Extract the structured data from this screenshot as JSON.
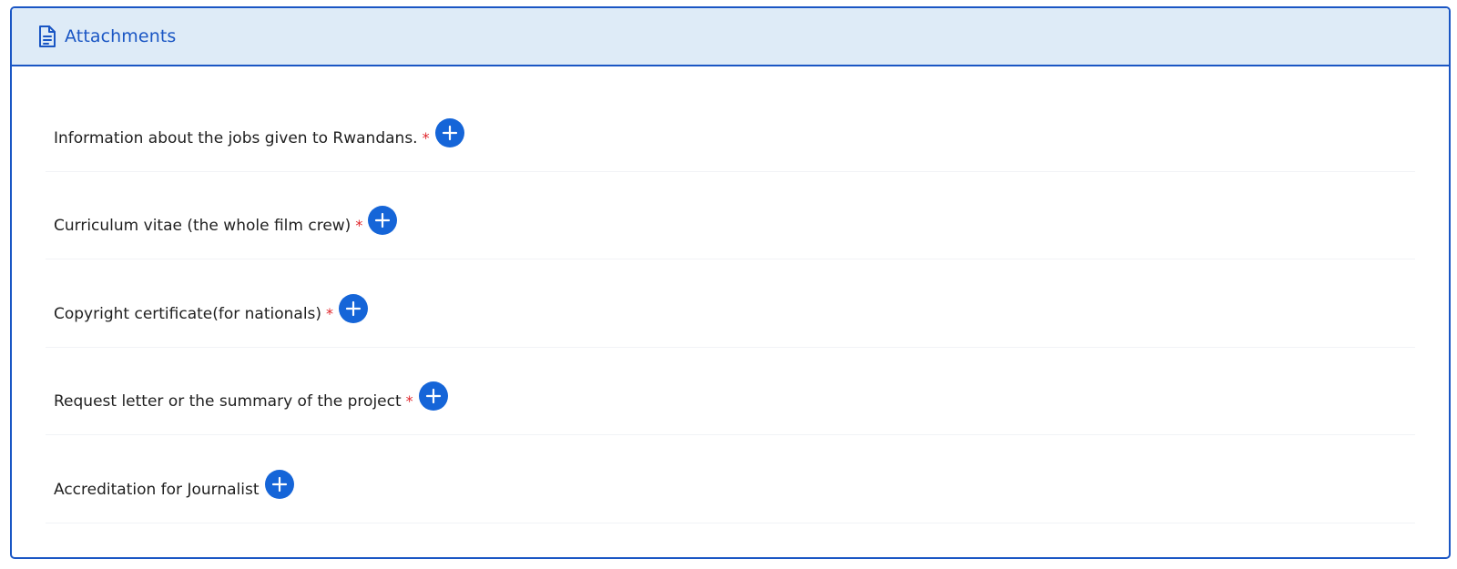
{
  "header": {
    "title": "Attachments",
    "icon": "document-icon"
  },
  "colors": {
    "accent": "#1a56c4",
    "header_bg": "#deebf7",
    "button": "#1565d8",
    "required": "#e0262c"
  },
  "attachments": [
    {
      "label": "Information about the jobs given to Rwandans.",
      "required": true,
      "required_mark": "*"
    },
    {
      "label": "Curriculum vitae (the whole film crew)",
      "required": true,
      "required_mark": "*"
    },
    {
      "label": "Copyright certificate(for nationals)",
      "required": true,
      "required_mark": "*"
    },
    {
      "label": "Request letter or the summary of the project",
      "required": true,
      "required_mark": "*"
    },
    {
      "label": "Accreditation for Journalist",
      "required": false
    }
  ]
}
